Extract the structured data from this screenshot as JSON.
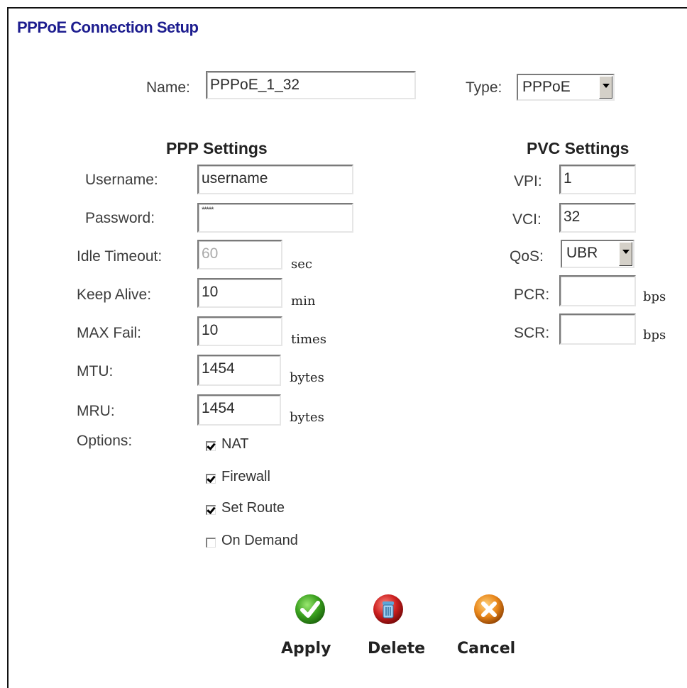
{
  "page": {
    "title": "PPPoE Connection Setup"
  },
  "connection": {
    "name_label": "Name:",
    "name_value": "PPPoE_1_32",
    "type_label": "Type:",
    "type_value": "PPPoE"
  },
  "ppp": {
    "heading": "PPP Settings",
    "username_label": "Username:",
    "username_value": "username",
    "password_label": "Password:",
    "password_value": "*****",
    "idle_label": "Idle Timeout:",
    "idle_value": "60",
    "idle_unit": "sec",
    "keepalive_label": "Keep Alive:",
    "keepalive_value": "10",
    "keepalive_unit": "min",
    "maxfail_label": "MAX Fail:",
    "maxfail_value": "10",
    "maxfail_unit": "times",
    "mtu_label": "MTU:",
    "mtu_value": "1454",
    "mtu_unit": "bytes",
    "mru_label": "MRU:",
    "mru_value": "1454",
    "mru_unit": "bytes",
    "options_label": "Options:",
    "options": [
      {
        "label": "NAT",
        "checked": true
      },
      {
        "label": "Firewall",
        "checked": true
      },
      {
        "label": "Set Route",
        "checked": true
      },
      {
        "label": "On Demand",
        "checked": false
      }
    ]
  },
  "pvc": {
    "heading": "PVC Settings",
    "vpi_label": "VPI:",
    "vpi_value": "1",
    "vci_label": "VCI:",
    "vci_value": "32",
    "qos_label": "QoS:",
    "qos_value": "UBR",
    "pcr_label": "PCR:",
    "pcr_value": "",
    "pcr_unit": "bps",
    "scr_label": "SCR:",
    "scr_value": "",
    "scr_unit": "bps"
  },
  "actions": {
    "apply": {
      "label": "Apply",
      "icon": "check-icon",
      "color": "#3aa01e"
    },
    "delete": {
      "label": "Delete",
      "icon": "trash-icon",
      "color": "#cc1f1f"
    },
    "cancel": {
      "label": "Cancel",
      "icon": "x-icon",
      "color": "#e8861a"
    }
  }
}
